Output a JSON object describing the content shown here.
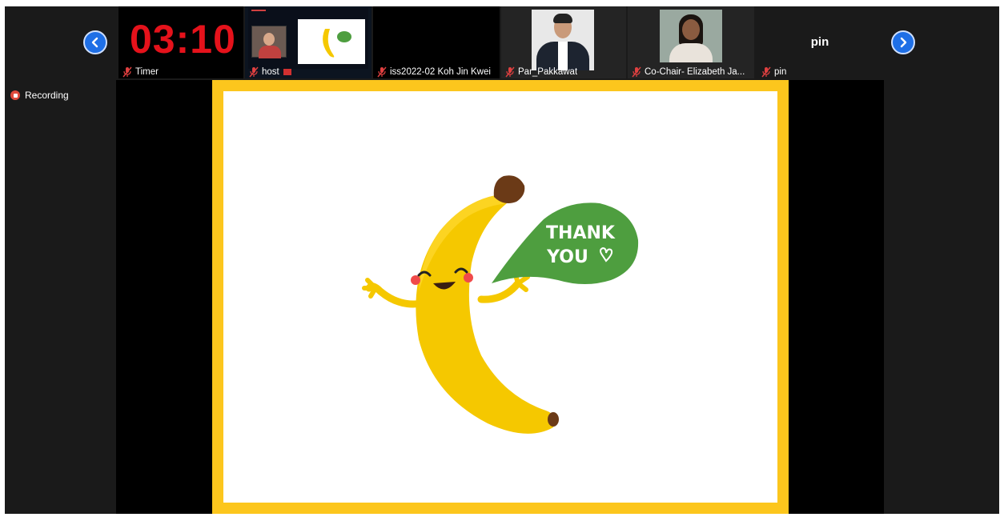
{
  "meeting": {
    "recording_label": "Recording",
    "nav_prev_icon": "chevron-left-icon",
    "nav_next_icon": "chevron-right-icon",
    "accent_color": "#1e6fe6",
    "recording_color": "#e04a3c"
  },
  "participants": [
    {
      "name": "Timer",
      "muted": true,
      "display": "03:10"
    },
    {
      "name": "host",
      "muted": true
    },
    {
      "name": "iss2022-02 Koh Jin Kwei",
      "muted": true
    },
    {
      "name": "Par_Pakkawat",
      "muted": true
    },
    {
      "name": "Co-Chair- Elizabeth Ja...",
      "muted": true
    },
    {
      "name": "pin",
      "muted": true,
      "display_name": "pin"
    }
  ],
  "slide": {
    "bubble_line1": "THANK",
    "bubble_line2": "YOU",
    "border_color": "#fcc61d",
    "bubble_color": "#4e9e3f"
  }
}
